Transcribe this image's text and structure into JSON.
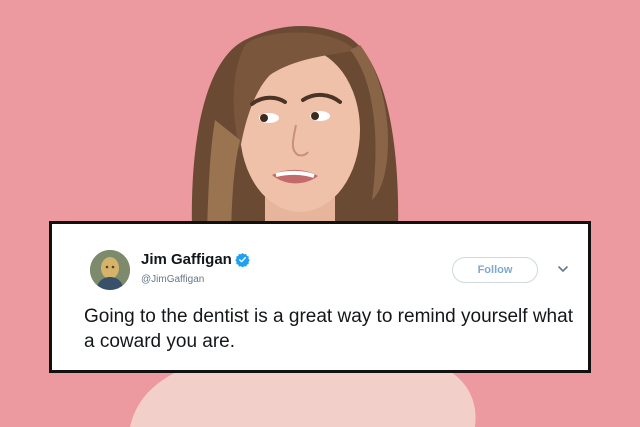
{
  "colors": {
    "background": "#ec9aa0",
    "card": "#ffffff",
    "card_border": "#111111",
    "verified": "#1da1f2",
    "text": "#14171a",
    "muted": "#657786",
    "follow_text": "#7fa9cf"
  },
  "tweet": {
    "author_name": "Jim Gaffigan",
    "handle": "@JimGaffigan",
    "follow_label": "Follow",
    "text": "Going to the dentist is a great way to remind yourself what a coward you are.",
    "verified_icon": "verified-badge-icon",
    "menu_icon": "chevron-down-icon"
  }
}
